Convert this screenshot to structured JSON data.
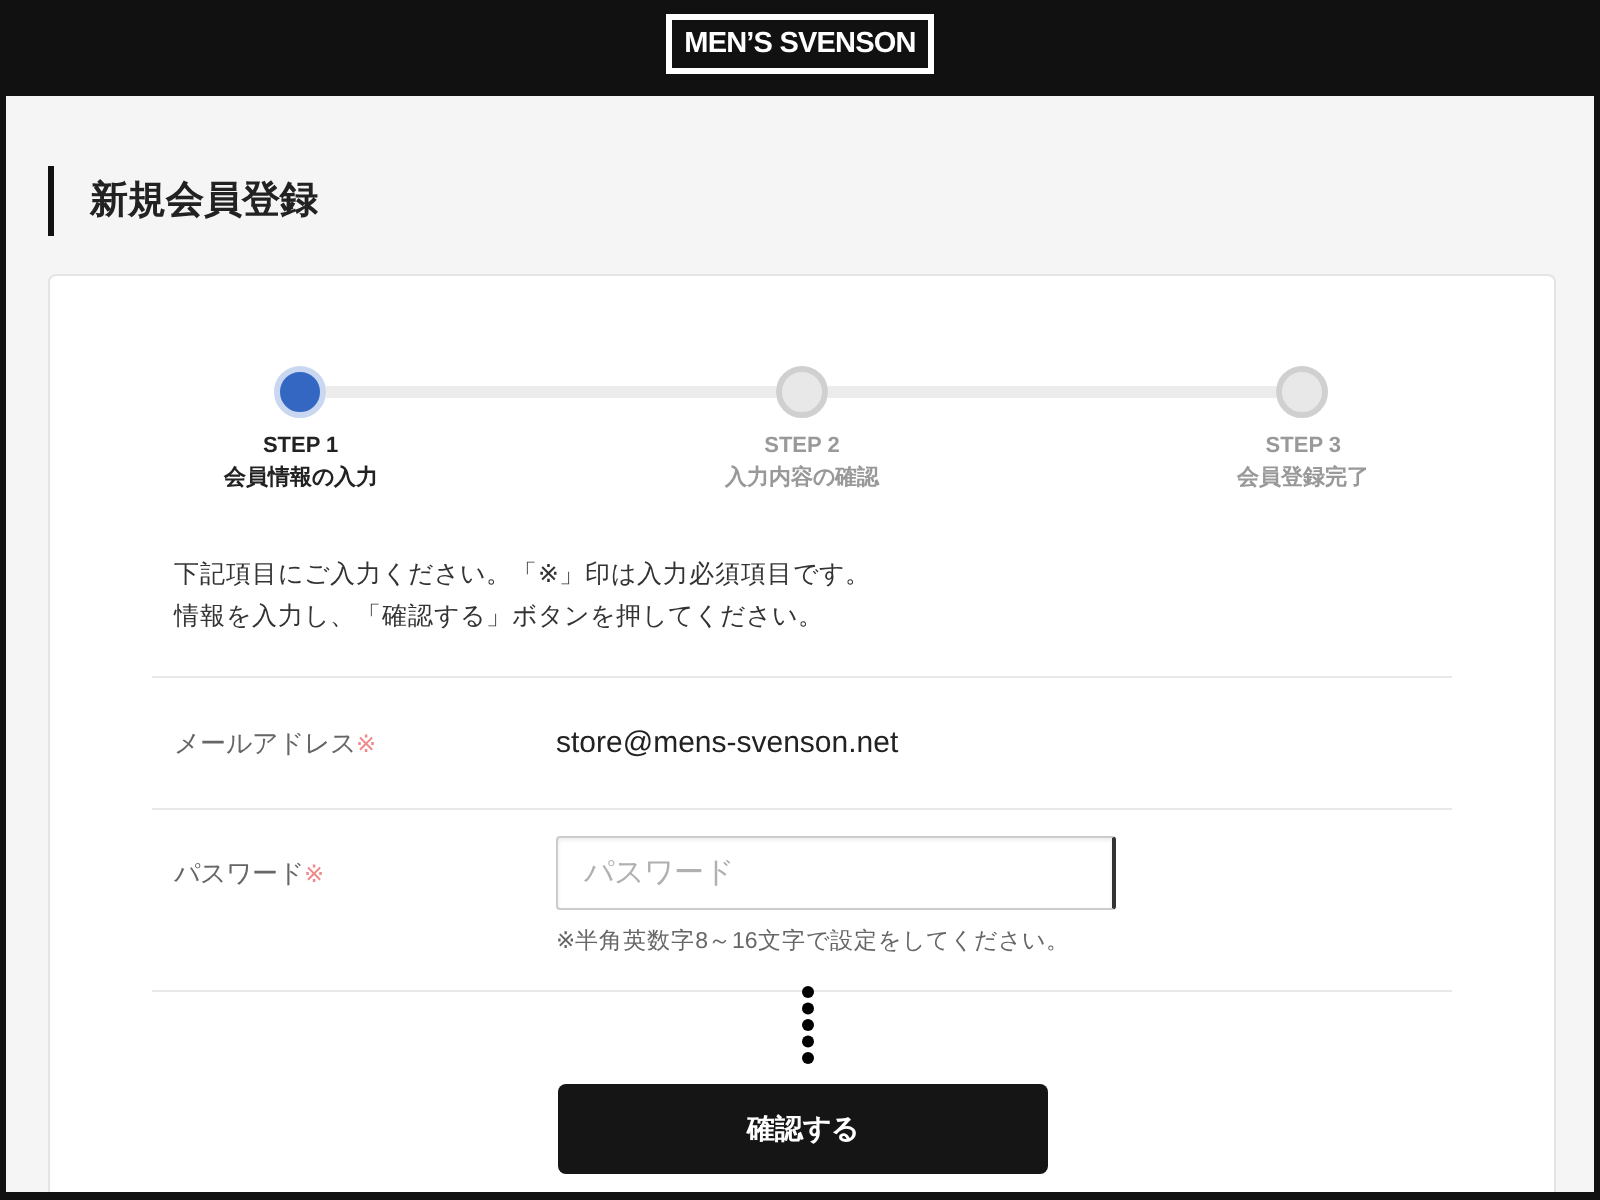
{
  "header": {
    "logo": "MEN’S SVENSON"
  },
  "page": {
    "title": "新規会員登録"
  },
  "steps": [
    {
      "label": "STEP 1",
      "caption": "会員情報の入力",
      "selected": true
    },
    {
      "label": "STEP 2",
      "caption": "入力内容の確認",
      "selected": false
    },
    {
      "label": "STEP 3",
      "caption": "会員登録完了",
      "selected": false
    }
  ],
  "instructions": [
    "下記項目にご入力ください。「※」印は入力必須項目です。",
    "情報を入力し、「確認する」ボタンを押してください。"
  ],
  "fields": [
    {
      "kind": "text",
      "label": "メールアドレス",
      "required_mark": "※",
      "value": "store@mens-svenson.net"
    },
    {
      "kind": "input",
      "label": "パスワード",
      "required_mark": "※",
      "placeholder": "パスワード",
      "hint": "※半角英数字8～16文字で設定をしてください。"
    }
  ],
  "submit": {
    "label": "確認する"
  }
}
